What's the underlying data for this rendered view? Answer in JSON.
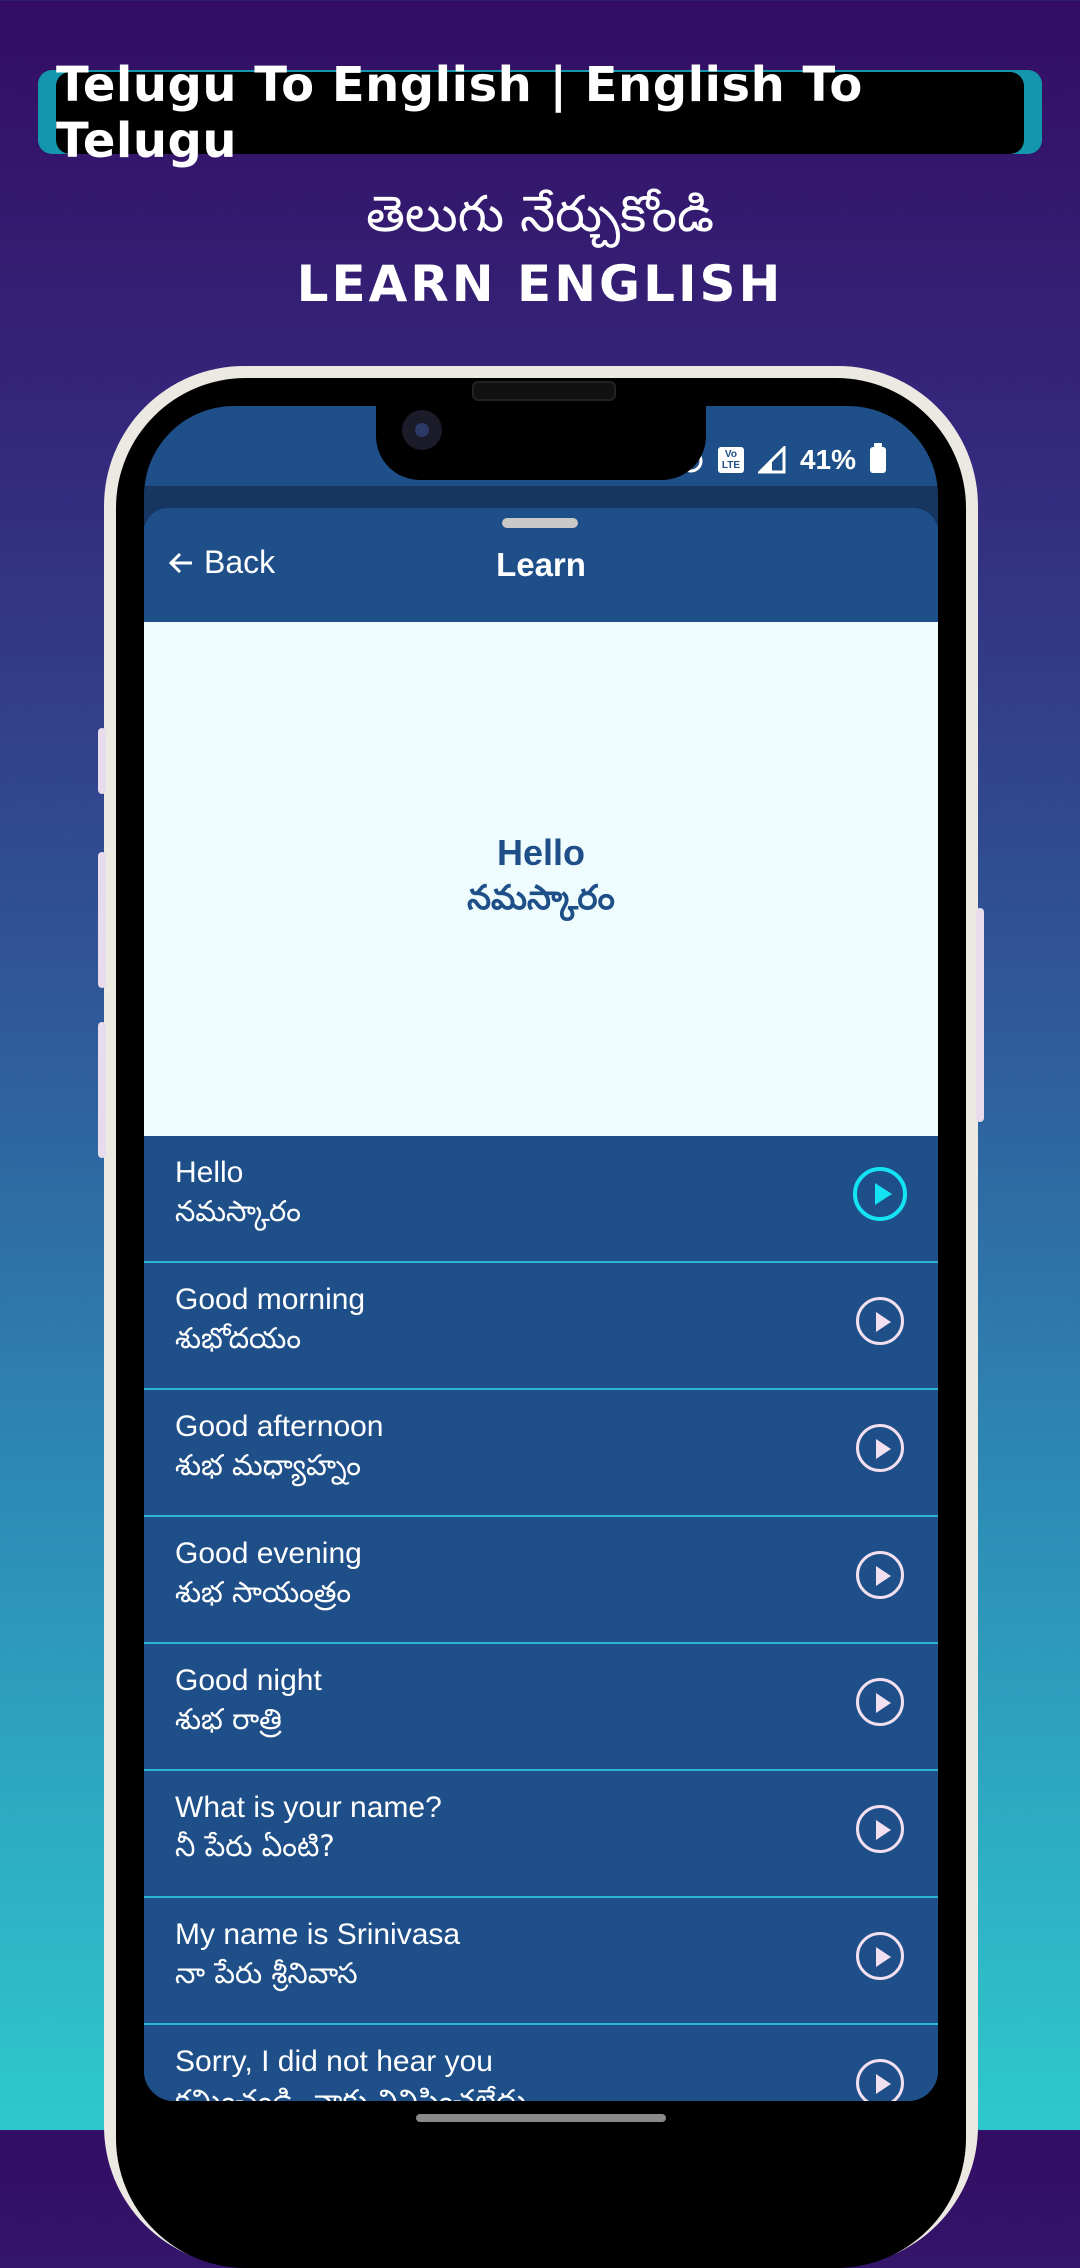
{
  "promo": {
    "banner": "Telugu To English | English To Telugu",
    "subtitle_telugu": "తెలుగు నేర్చుకోండి",
    "subtitle_english": "LEARN ENGLISH"
  },
  "status_bar": {
    "battery": "41%",
    "icons": [
      "alarm-icon",
      "volte-icon",
      "signal-icon",
      "battery-icon"
    ],
    "volte_top": "Vo",
    "volte_bottom": "LTE"
  },
  "header": {
    "back_label": "Back",
    "back_icon": "arrow-left-icon",
    "title": "Learn"
  },
  "display": {
    "english": "Hello",
    "telugu": "నమస్కారం"
  },
  "phrases": [
    {
      "english": "Hello",
      "telugu": "నమస్కారం",
      "active": true
    },
    {
      "english": "Good morning",
      "telugu": "శుభోదయం",
      "active": false
    },
    {
      "english": "Good afternoon",
      "telugu": "శుభ మధ్యాహ్నం",
      "active": false
    },
    {
      "english": "Good evening",
      "telugu": "శుభ సాయంత్రం",
      "active": false
    },
    {
      "english": "Good night",
      "telugu": "శుభ రాత్రి",
      "active": false
    },
    {
      "english": "What is your name?",
      "telugu": "నీ పేరు ఏంటి?",
      "active": false
    },
    {
      "english": "My name is Srinivasa",
      "telugu": "నా పేరు శ్రీనివాస",
      "active": false
    },
    {
      "english": "Sorry, I did not hear you",
      "telugu": "క్షమించండి, నాకు వినిపించలేదు",
      "active": false
    }
  ],
  "colors": {
    "app_blue": "#1f4f89",
    "accent_cyan": "#13e3f3",
    "divider": "#2bb6cf",
    "display_bg": "#effcfd"
  }
}
